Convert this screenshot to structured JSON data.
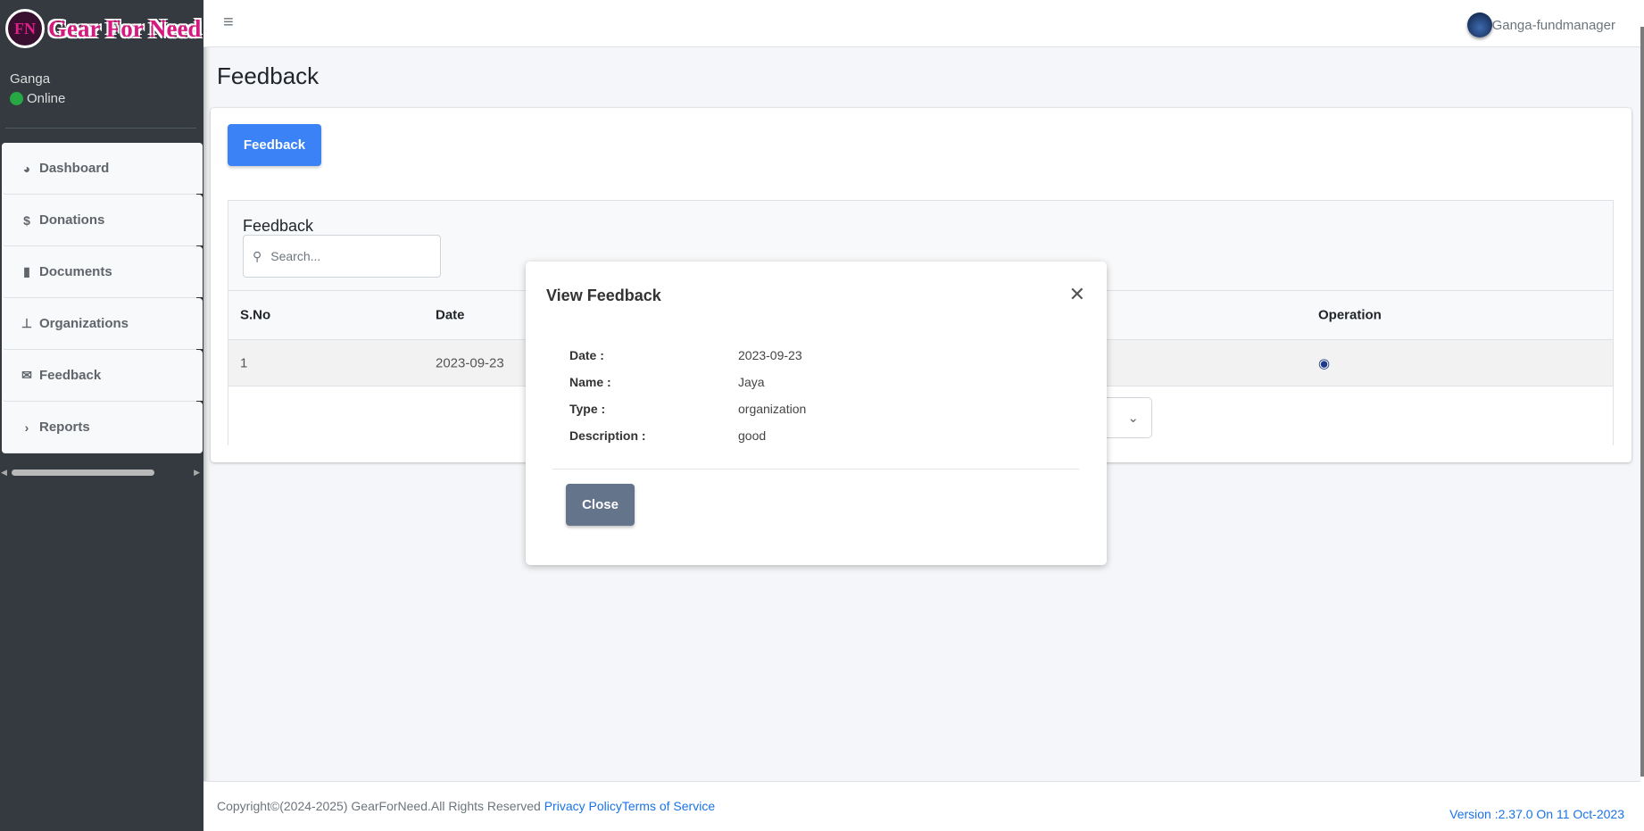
{
  "brand": {
    "logo_text": "Gear For Need",
    "logo_mark": "FNG"
  },
  "sidebar": {
    "user_name": "Ganga",
    "status": "Online",
    "status_color": "#28a745",
    "items": [
      {
        "label": "Dashboard",
        "icon": "chart-pie-icon"
      },
      {
        "label": "Donations",
        "icon": "donate-icon"
      },
      {
        "label": "Documents",
        "icon": "file-icon"
      },
      {
        "label": "Organizations",
        "icon": "sitemap-icon"
      },
      {
        "label": "Feedback",
        "icon": "envelope-icon"
      },
      {
        "label": "Reports",
        "icon": "chevron-right-icon"
      }
    ]
  },
  "header": {
    "user": "Ganga-fundmanager"
  },
  "page": {
    "title": "Feedback",
    "feedback_button": "Feedback"
  },
  "table": {
    "title": "Feedback",
    "search_placeholder": "Search...",
    "columns": [
      "S.No",
      "Date",
      "Operation"
    ],
    "rows": [
      {
        "sno": "1",
        "date": "2023-09-23"
      }
    ],
    "page_size_partial": "0"
  },
  "modal": {
    "title": "View Feedback",
    "fields": [
      {
        "label": "Date :",
        "value": "2023-09-23"
      },
      {
        "label": "Name :",
        "value": "Jaya"
      },
      {
        "label": "Type :",
        "value": "organization"
      },
      {
        "label": "Description :",
        "value": "good"
      }
    ],
    "close_label": "Close"
  },
  "footer": {
    "copyright": "Copyright©(2024-2025) GearForNeed.All Rights Reserved ",
    "privacy": "Privacy Policy",
    "terms": "Terms of Service",
    "version": "Version :2.37.0 On 11 Oct-2023"
  },
  "colors": {
    "primary": "#3b82f6",
    "sidebar": "#343a40",
    "close_button": "#64748b"
  }
}
